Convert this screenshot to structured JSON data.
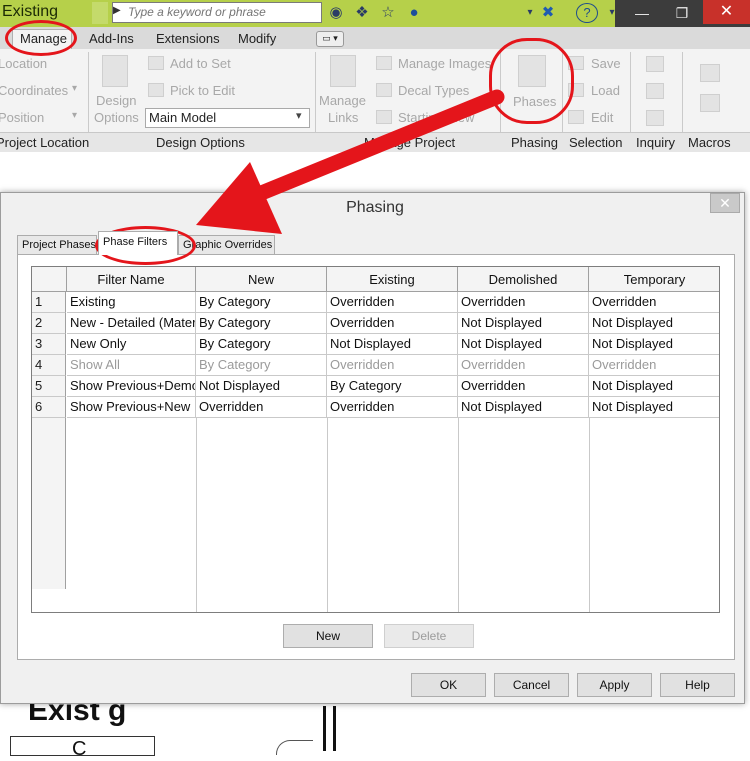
{
  "titlebar": {
    "title": "Existing",
    "search_placeholder": "Type a keyword or phrase"
  },
  "ribbon": {
    "tabs": [
      "Manage",
      "Add-Ins",
      "Extensions",
      "Modify"
    ],
    "location": "Location",
    "coordinates": "Coordinates",
    "position": "Position",
    "design_options_btn_line1": "Design",
    "design_options_btn_line2": "Options",
    "add_to_set": "Add to Set",
    "pick_to_edit": "Pick to Edit",
    "main_model": "Main Model",
    "manage_links_line1": "Manage",
    "manage_links_line2": "Links",
    "manage_images": "Manage Images",
    "decal_types": "Decal Types",
    "starting_view": "Starting View",
    "phases": "Phases",
    "save": "Save",
    "load": "Load",
    "edit": "Edit",
    "footers": {
      "project_location": "Project Location",
      "design_options": "Design Options",
      "manage_project": "Manage Project",
      "phasing": "Phasing",
      "selection": "Selection",
      "inquiry": "Inquiry",
      "macros": "Macros"
    }
  },
  "background": {
    "fragment_a": "Exist g",
    "fragment_b": "C"
  },
  "dialog": {
    "title": "Phasing",
    "tabs": [
      "Project Phases",
      "Phase Filters",
      "Graphic Overrides"
    ],
    "columns": [
      "Filter Name",
      "New",
      "Existing",
      "Demolished",
      "Temporary"
    ],
    "rows": [
      {
        "num": "1",
        "name": "Existing",
        "new": "By Category",
        "existing": "Overridden",
        "demolished": "Overridden",
        "temporary": "Overridden"
      },
      {
        "num": "2",
        "name": "New - Detailed (Material)",
        "new": "By Category",
        "existing": "Overridden",
        "demolished": "Not Displayed",
        "temporary": "Not Displayed"
      },
      {
        "num": "3",
        "name": "New Only",
        "new": "By Category",
        "existing": "Not Displayed",
        "demolished": "Not Displayed",
        "temporary": "Not Displayed"
      },
      {
        "num": "4",
        "name": "Show All",
        "new": "By Category",
        "existing": "Overridden",
        "demolished": "Overridden",
        "temporary": "Overridden"
      },
      {
        "num": "5",
        "name": "Show Previous+Demo",
        "new": "Not Displayed",
        "existing": "By Category",
        "demolished": "Overridden",
        "temporary": "Not Displayed"
      },
      {
        "num": "6",
        "name": "Show Previous+New",
        "new": "Overridden",
        "existing": "Overridden",
        "demolished": "Not Displayed",
        "temporary": "Not Displayed"
      }
    ],
    "new_button": "New",
    "delete_button": "Delete",
    "ok": "OK",
    "cancel": "Cancel",
    "apply": "Apply",
    "help": "Help"
  },
  "colors": {
    "title_green": "#b6d04a",
    "annotation_red": "#e4151b",
    "close_red": "#c8312a"
  }
}
